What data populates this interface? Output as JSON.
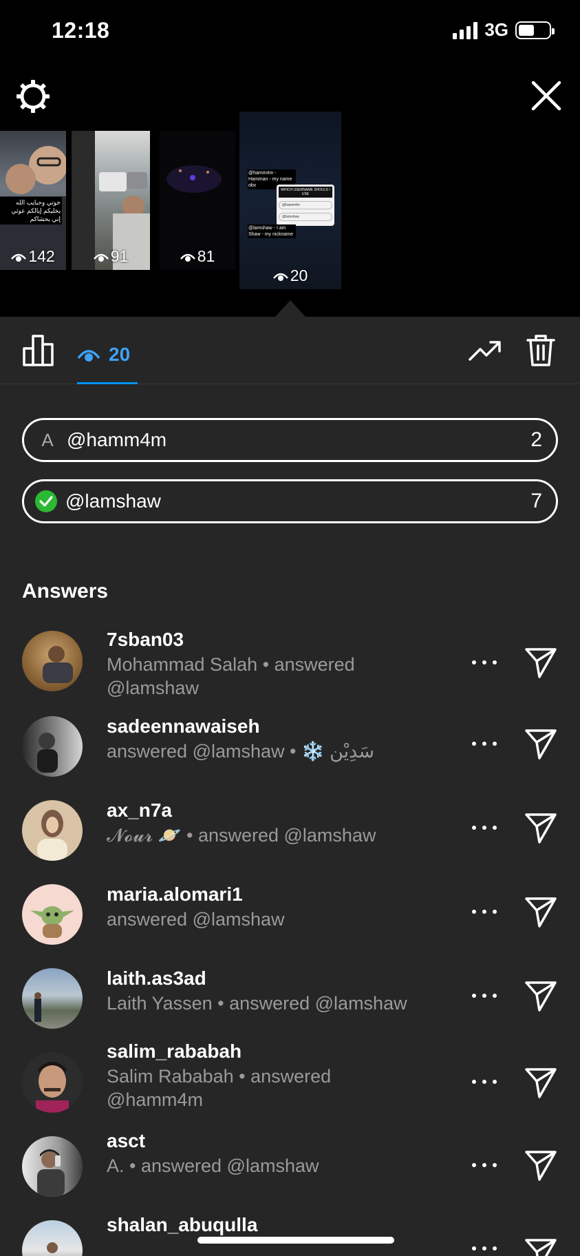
{
  "status_bar": {
    "time": "12:18",
    "network": "3G"
  },
  "stories": [
    {
      "views": "142",
      "caption": "خوتي وحبايب الله يخليكم إيالكم عوثي إني يحشاكم"
    },
    {
      "views": "91"
    },
    {
      "views": "81"
    },
    {
      "views": "20",
      "poll_title": "WHICH USERNAME SHOULD I USE",
      "caption1": "@hamm4m - Hamman - my name obv",
      "caption2": "@lamshaw - I am Shaw - my nickname",
      "opt1": "@hamm4m",
      "opt2": "@lamshaw"
    }
  ],
  "tabs": {
    "viewers_count": "20"
  },
  "poll": {
    "options": [
      {
        "letter": "A",
        "label": "@hamm4m",
        "count": "2",
        "correct": false
      },
      {
        "letter": "",
        "label": "@lamshaw",
        "count": "7",
        "correct": true
      }
    ]
  },
  "answers_title": "Answers",
  "answers": [
    {
      "username": "7sban03",
      "subtitle": "Mohammad Salah • answered @lamshaw"
    },
    {
      "username": "sadeennawaiseh",
      "subtitle": "answered @lamshaw • ❄️ سَدِيْن"
    },
    {
      "username": "ax_n7a",
      "subtitle": "𝓝𝓸𝓾𝓻 🪐 • answered @lamshaw"
    },
    {
      "username": "maria.alomari1",
      "subtitle": "answered @lamshaw"
    },
    {
      "username": "laith.as3ad",
      "subtitle": "Laith Yassen • answered @lamshaw"
    },
    {
      "username": "salim_rababah",
      "subtitle": "Salim Rababah • answered @hamm4m"
    },
    {
      "username": "asct",
      "subtitle": "A. • answered @lamshaw"
    },
    {
      "username": "shalan_abuqulla",
      "subtitle": ""
    }
  ]
}
